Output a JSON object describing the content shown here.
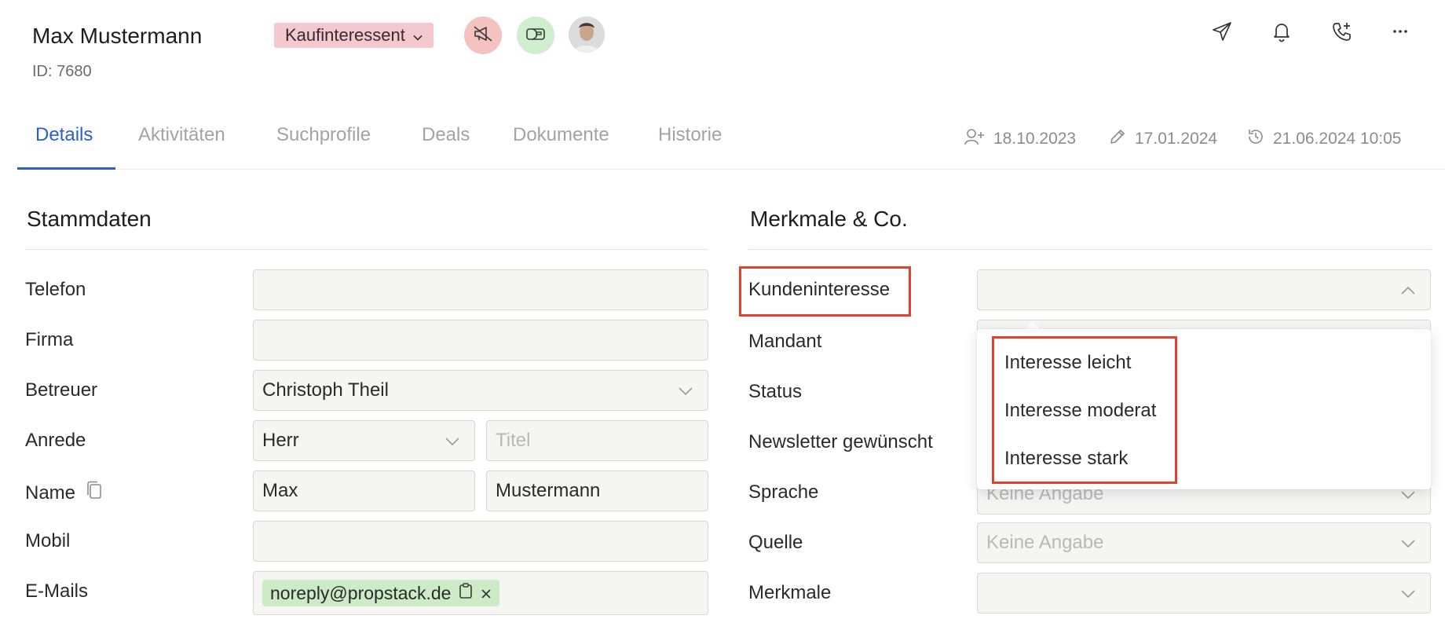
{
  "contact": {
    "name": "Max Mustermann",
    "id_text": "ID: 7680",
    "type_label": "Kaufinteressent"
  },
  "header_actions": [
    "send-icon",
    "bell-icon",
    "phone-add-icon",
    "more-icon"
  ],
  "tabs": [
    {
      "label": "Details",
      "active": true
    },
    {
      "label": "Aktivitäten"
    },
    {
      "label": "Suchprofile"
    },
    {
      "label": "Deals"
    },
    {
      "label": "Dokumente"
    },
    {
      "label": "Historie"
    }
  ],
  "meta": {
    "created": "18.10.2023",
    "edited": "17.01.2024",
    "last_activity": "21.06.2024 10:05"
  },
  "stammdaten": {
    "title": "Stammdaten",
    "labels": {
      "telefon": "Telefon",
      "firma": "Firma",
      "betreuer": "Betreuer",
      "anrede": "Anrede",
      "name": "Name",
      "mobil": "Mobil",
      "emails": "E-Mails"
    },
    "values": {
      "betreuer": "Christoph Theil",
      "anrede": "Herr",
      "titel_placeholder": "Titel",
      "vorname": "Max",
      "nachname": "Mustermann",
      "email": "noreply@propstack.de"
    }
  },
  "merkmale": {
    "title": "Merkmale & Co.",
    "labels": {
      "kundeninteresse": "Kundeninteresse",
      "mandant": "Mandant",
      "status": "Status",
      "newsletter": "Newsletter gewünscht",
      "sprache": "Sprache",
      "quelle": "Quelle",
      "merkmale": "Merkmale"
    },
    "values": {
      "sprache": "Keine Angabe",
      "quelle": "Keine Angabe"
    },
    "dropdown_options": [
      "Interesse leicht",
      "Interesse moderat",
      "Interesse stark"
    ]
  },
  "colors": {
    "accent": "#2b5fd0",
    "highlight": "#e2412c",
    "type_badge": "#f3c9cf",
    "email_chip": "#cdebc7"
  }
}
